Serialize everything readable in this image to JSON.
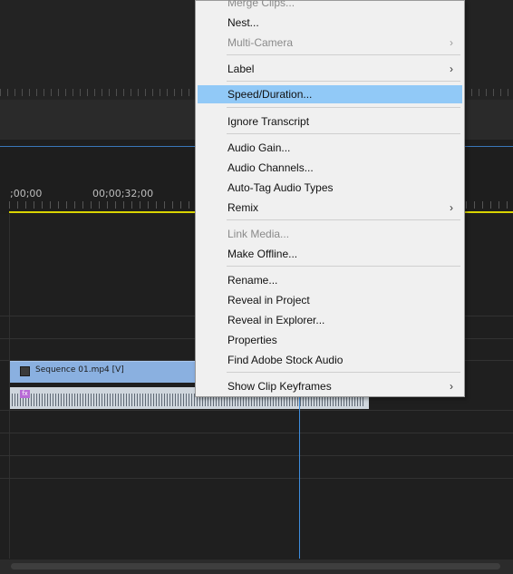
{
  "timeline": {
    "time_labels": [
      ";00;00",
      "00;00;32;00"
    ],
    "video_clip_title": "Sequence 01.mp4 [V]",
    "audio_clip_badge": "fx"
  },
  "context_menu": {
    "items": [
      {
        "label": "Merge Clips...",
        "disabled": true
      },
      {
        "label": "Nest..."
      },
      {
        "label": "Multi-Camera",
        "disabled": true,
        "submenu": true
      },
      {
        "label": "Label",
        "submenu": true
      },
      {
        "label": "Speed/Duration...",
        "highlighted": true
      },
      {
        "label": "Ignore Transcript"
      },
      {
        "label": "Audio Gain..."
      },
      {
        "label": "Audio Channels..."
      },
      {
        "label": "Auto-Tag Audio Types"
      },
      {
        "label": "Remix",
        "submenu": true
      },
      {
        "label": "Link Media...",
        "disabled": true
      },
      {
        "label": "Make Offline..."
      },
      {
        "label": "Rename..."
      },
      {
        "label": "Reveal in Project"
      },
      {
        "label": "Reveal in Explorer..."
      },
      {
        "label": "Properties"
      },
      {
        "label": "Find Adobe Stock Audio"
      },
      {
        "label": "Show Clip Keyframes",
        "submenu": true
      }
    ],
    "submenu_arrow": "›"
  }
}
